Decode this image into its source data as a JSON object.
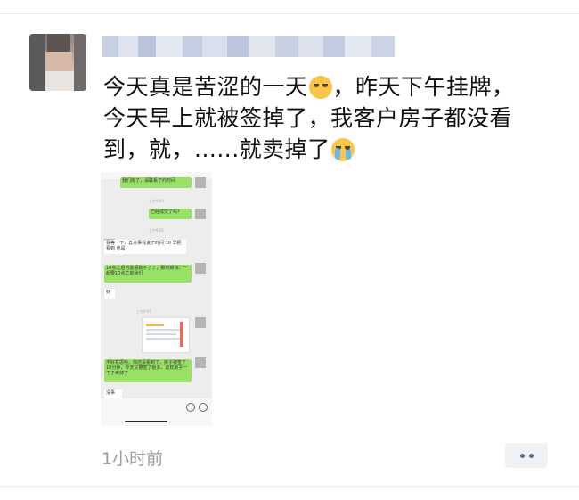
{
  "post": {
    "line1": "今天真是苦涩的一天",
    "line1_after_emoji": "，昨天下午挂牌，",
    "line2": "今天早上就被签掉了，我客户房子都没看",
    "line3": "到，就，......就卖掉了",
    "emoji1": "grimace-emoji",
    "emoji2": "crying-emoji"
  },
  "screenshot": {
    "messages": [
      {
        "side": "right",
        "text": "我们房了，请联系了约时间"
      },
      {
        "side": "right",
        "text": "已经成交了吗？"
      },
      {
        "side": "left",
        "text": "我等一下，去点事我说了时间 10 早把看到 也是"
      },
      {
        "side": "right",
        "text": "10点之后可能请数不了了，那时候快，一起要10点之前我们"
      },
      {
        "side": "left",
        "text": "好"
      },
      {
        "side": "right",
        "text": "不好意思哈，你还没看到了，房子被签了10分钟，今天又被签了很多，这样房子一下子卖掉了"
      },
      {
        "side": "left",
        "text": "没事"
      }
    ],
    "timestamps": [
      "上午9:00",
      "上午9:01",
      "上午9:07"
    ]
  },
  "meta": {
    "time_ago": "1小时前"
  },
  "colors": {
    "text": "#111111",
    "time": "#9d9d9d",
    "more_dots": "#576b95",
    "wechat_green": "#98e165"
  }
}
